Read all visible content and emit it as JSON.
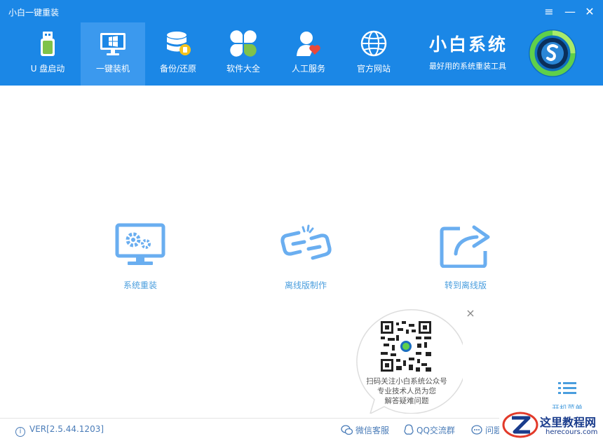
{
  "window": {
    "title": "小白一键重装",
    "menu_glyph": "≡",
    "minimize_glyph": "—",
    "close_glyph": "✕"
  },
  "nav": {
    "items": [
      {
        "label": "U 盘启动",
        "icon": "usb-drive-icon"
      },
      {
        "label": "一键装机",
        "icon": "monitor-windows-icon",
        "active": true
      },
      {
        "label": "备份/还原",
        "icon": "database-backup-icon"
      },
      {
        "label": "软件大全",
        "icon": "software-clover-icon"
      },
      {
        "label": "人工服务",
        "icon": "person-heart-icon"
      },
      {
        "label": "官方网站",
        "icon": "globe-icon"
      }
    ]
  },
  "brand": {
    "name": "小白系统",
    "slogan": "最好用的系统重装工具",
    "logo_icon": "xiaobai-logo-icon"
  },
  "actions": [
    {
      "label": "系统重装",
      "icon": "monitor-gears-icon"
    },
    {
      "label": "离线版制作",
      "icon": "broken-link-icon"
    },
    {
      "label": "转到离线版",
      "icon": "share-arrow-icon"
    }
  ],
  "popup": {
    "close_glyph": "×",
    "lines": [
      "扫码关注小白系统公众号",
      "专业技术人员为您",
      "解答疑难问题"
    ]
  },
  "start_menu": {
    "label": "开机菜单"
  },
  "footer": {
    "version": "VER[2.5.44.1203]",
    "info_glyph": "i",
    "links": [
      {
        "label": "微信客服",
        "icon": "wechat-icon"
      },
      {
        "label": "QQ交流群",
        "icon": "qq-icon"
      },
      {
        "label": "问题",
        "icon": "chat-bubble-icon"
      }
    ]
  },
  "watermark": {
    "text_cn": "这里教程网",
    "text_en": "herecours.com"
  },
  "colors": {
    "header": "#1b87e6",
    "nav_active": "#3b99ee",
    "accent": "#4a9ede",
    "link": "#4a7cb8"
  }
}
